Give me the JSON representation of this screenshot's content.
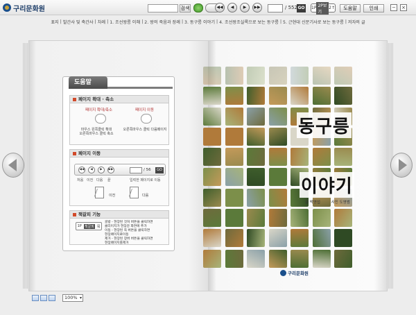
{
  "app": {
    "title": "구리문화원"
  },
  "toolbar": {
    "search_placeholder": "",
    "search_button": "검색",
    "page_current": "",
    "page_total": "/ 552",
    "go_label": "GO",
    "view_seg": [
      "1P",
      "2P보기",
      "2↑"
    ],
    "print_button": "도움말",
    "print2_button": "인쇄",
    "nav": [
      "◀◀",
      "◀",
      "▶",
      "▶▶"
    ],
    "win_min": "−",
    "win_close": "×"
  },
  "chapters": [
    "표지",
    "발간사 및 축간사",
    "차례",
    "1. 조선왕릉 이해",
    "2. 왕의 죽음과 장례",
    "3. 동구릉 이야기",
    "4. 조선왕조실록으로 보는 동구릉",
    "5. 근현대 신문기사로 보는 동구릉",
    "저자의 글"
  ],
  "help": {
    "tab_title": "도움말",
    "sections": {
      "zoom": {
        "title": "페이지 확대 · 축소",
        "left_label": "페이지 확대/축소",
        "right_label": "페이지 이동",
        "left_note_1": "마우스 왼쪽클릭 확대",
        "left_note_2": "오른쪽마우스 클릭 축소",
        "right_note": "오른쪽마우스 클릭 다음페이지"
      },
      "move": {
        "title": "페이지 이동",
        "nav": [
          "◀◀",
          "◀",
          "▶",
          "▶▶"
        ],
        "total": "/ 56",
        "go": "GO",
        "labels": [
          "처음",
          "이전",
          "다음",
          "끝",
          "입력한 페이지로 이동"
        ],
        "prev_label": "이전",
        "next_label": "다음"
      },
      "bookmark": {
        "title": "책갈피 기능",
        "ctrl": [
          "1P",
          "책갈피",
          "목"
        ],
        "lines": [
          "골방 - 현장된 것처 버튼을 클릭하면",
          "클리이지가 현장감 화면에 추가",
          "이동 - 현장된 쪽 버튼을 클릭하면",
          "현장페이지로이동",
          "제거 - 현장된 장버 버튼을 클릭하면",
          "현장페이지를제거"
        ]
      }
    }
  },
  "cover": {
    "title_line1": "동구릉",
    "title_line2": "이야기",
    "author": "글 박명섭",
    "photographer": "사진 도영범",
    "publisher": "구리문화원"
  },
  "bottom": {
    "zoom_value": "100%"
  },
  "colors": {
    "accent": "#1a4f8b",
    "dark_btn": "#3b3b3b",
    "help_red": "#d24a2a"
  }
}
